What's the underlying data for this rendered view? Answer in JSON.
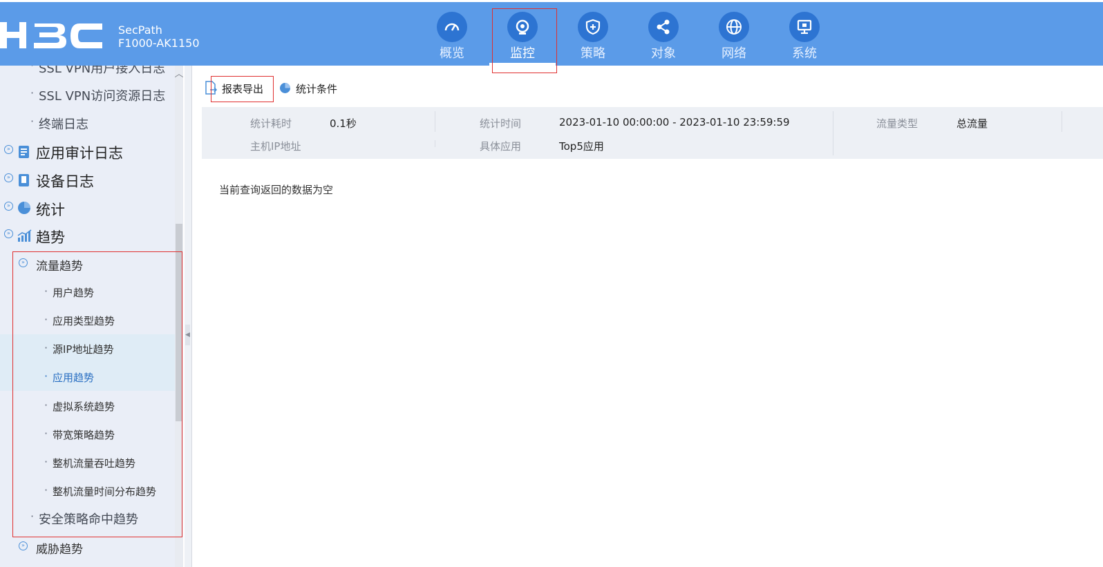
{
  "header": {
    "logo": "H3C",
    "product_line1": "SecPath",
    "product_line2": "F1000-AK1150",
    "nav": [
      {
        "label": "概览",
        "icon": "dashboard-icon"
      },
      {
        "label": "监控",
        "icon": "camera-icon",
        "active": true
      },
      {
        "label": "策略",
        "icon": "shield-icon"
      },
      {
        "label": "对象",
        "icon": "share-icon"
      },
      {
        "label": "网络",
        "icon": "globe-icon"
      },
      {
        "label": "系统",
        "icon": "monitor-icon"
      }
    ]
  },
  "sidebar": {
    "items": [
      {
        "label": "SSL VPN用户接入日志"
      },
      {
        "label": "SSL VPN访问资源日志"
      },
      {
        "label": "终端日志"
      },
      {
        "label": "应用审计日志"
      },
      {
        "label": "设备日志"
      },
      {
        "label": "统计"
      },
      {
        "label": "趋势"
      },
      {
        "label": "流量趋势"
      },
      {
        "label": "用户趋势"
      },
      {
        "label": "应用类型趋势"
      },
      {
        "label": "源IP地址趋势"
      },
      {
        "label": "应用趋势"
      },
      {
        "label": "虚拟系统趋势"
      },
      {
        "label": "带宽策略趋势"
      },
      {
        "label": "整机流量吞吐趋势"
      },
      {
        "label": "整机流量时间分布趋势"
      },
      {
        "label": "安全策略命中趋势"
      },
      {
        "label": "威胁趋势"
      }
    ]
  },
  "toolbar": {
    "export_label": "报表导出",
    "conditions_label": "统计条件"
  },
  "stats": {
    "elapsed_label": "统计耗时",
    "elapsed_value": "0.1秒",
    "time_label": "统计时间",
    "time_value": "2023-01-10 00:00:00 - 2023-01-10 23:59:59",
    "traffic_type_label": "流量类型",
    "traffic_type_value": "总流量",
    "host_ip_label": "主机IP地址",
    "app_label": "具体应用",
    "app_value": "Top5应用"
  },
  "empty_message": "当前查询返回的数据为空",
  "colors": {
    "header_bg": "#5b9be8",
    "nav_circle": "#2d74d2",
    "sidebar_bg": "#eaeef7",
    "active_text": "#2a6fc2",
    "highlight_box": "#e03030"
  }
}
